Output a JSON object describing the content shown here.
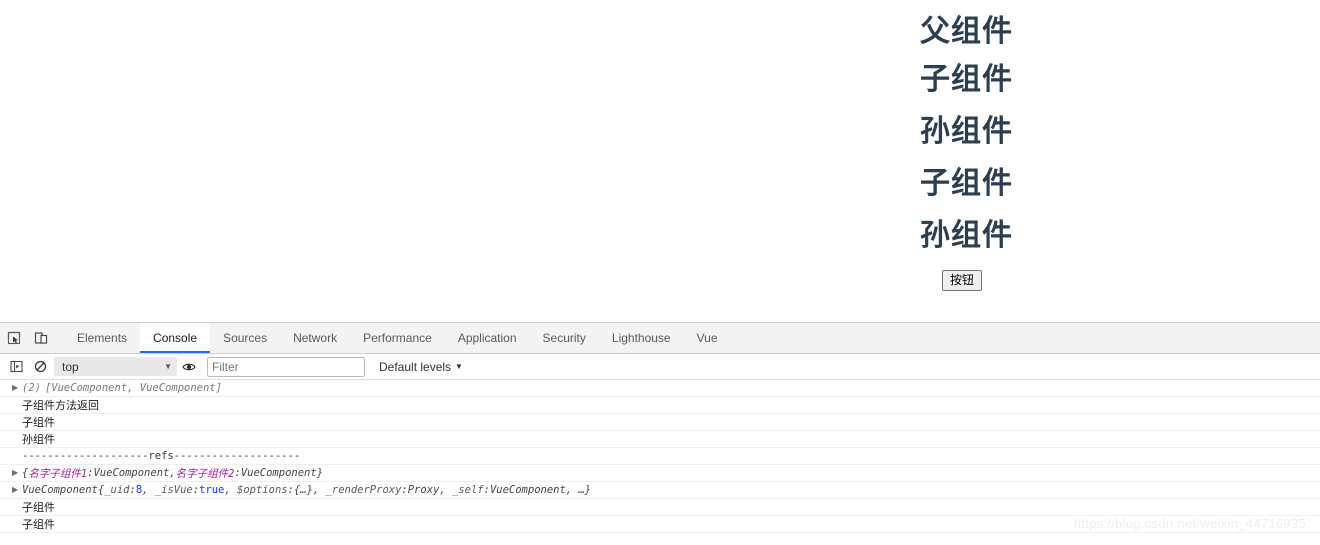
{
  "page": {
    "headings": [
      {
        "text": "父组件"
      },
      {
        "text": "子组件"
      },
      {
        "text": "孙组件"
      },
      {
        "text": "子组件"
      },
      {
        "text": "孙组件"
      }
    ],
    "button_label": "按钮",
    "heading_color": "#2c3e50"
  },
  "devtools": {
    "icons": {
      "inspect": "inspect-element-icon",
      "device": "device-toolbar-icon",
      "sidebar": "console-sidebar-icon",
      "clear": "clear-console-icon",
      "eye": "live-expression-icon"
    },
    "tabs": [
      {
        "label": "Elements",
        "active": false
      },
      {
        "label": "Console",
        "active": true
      },
      {
        "label": "Sources",
        "active": false
      },
      {
        "label": "Network",
        "active": false
      },
      {
        "label": "Performance",
        "active": false
      },
      {
        "label": "Application",
        "active": false
      },
      {
        "label": "Security",
        "active": false
      },
      {
        "label": "Lighthouse",
        "active": false
      },
      {
        "label": "Vue",
        "active": false
      }
    ],
    "active_tab_underline_color": "#1a73e8",
    "filterbar": {
      "context_value": "top",
      "context_caret": "▼",
      "filter_placeholder": "Filter",
      "filter_value": "",
      "levels_label": "Default levels",
      "levels_caret": "▼"
    },
    "messages": [
      {
        "id": "m1",
        "expandable": true,
        "disclosure": "▶",
        "kind": "array",
        "prefix": "(2)",
        "body": "[VueComponent, VueComponent]"
      },
      {
        "id": "m2",
        "expandable": false,
        "kind": "text",
        "body": "子组件方法返回"
      },
      {
        "id": "m3",
        "expandable": false,
        "kind": "text",
        "body": "子组件"
      },
      {
        "id": "m4",
        "expandable": false,
        "kind": "text",
        "body": "孙组件"
      },
      {
        "id": "m5",
        "expandable": false,
        "kind": "mono-text",
        "body": "--------------------refs--------------------"
      },
      {
        "id": "m6",
        "expandable": true,
        "disclosure": "▶",
        "kind": "refs-object",
        "open_brace": "{",
        "key1": "名字子组件1",
        "sep1": ": ",
        "val1": "VueComponent",
        "comma": ", ",
        "key2": "名字子组件2",
        "sep2": ": ",
        "val2": "VueComponent",
        "close_brace": "}"
      },
      {
        "id": "m7",
        "expandable": true,
        "disclosure": "▶",
        "kind": "vue-instance",
        "ctor": "VueComponent ",
        "open_brace": "{",
        "props": [
          {
            "key": "_uid",
            "value": "8",
            "value_type": "number"
          },
          {
            "key": "_isVue",
            "value": "true",
            "value_type": "boolean"
          },
          {
            "key": "$options",
            "value": "{…}",
            "value_type": "object"
          },
          {
            "key": "_renderProxy",
            "value": "Proxy",
            "value_type": "plain"
          },
          {
            "key": "_self",
            "value": "VueComponent",
            "value_type": "plain"
          }
        ],
        "ellipsis": "…",
        "close_brace": "}"
      },
      {
        "id": "m8",
        "expandable": false,
        "kind": "text",
        "body": "子组件"
      },
      {
        "id": "m9",
        "expandable": false,
        "kind": "text",
        "body": "子组件"
      }
    ]
  },
  "watermark": "https://blog.csdn.net/weixin_44716935"
}
